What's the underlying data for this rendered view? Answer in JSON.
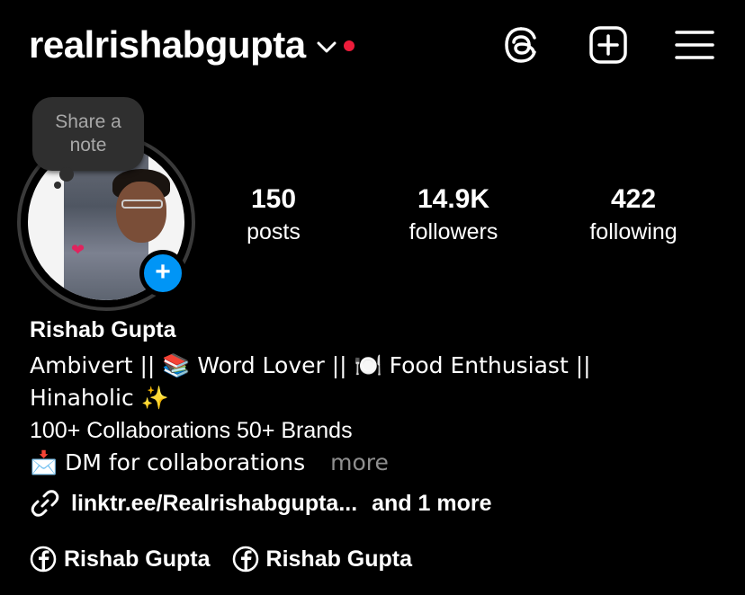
{
  "header": {
    "username": "realrishabgupta",
    "notification_color": "#ed1c3a"
  },
  "profile": {
    "note_placeholder": "Share a note",
    "add_story_symbol": "+",
    "avatar_heart": "❤"
  },
  "stats": [
    {
      "value": "150",
      "label": "posts"
    },
    {
      "value": "14.9K",
      "label": "followers"
    },
    {
      "value": "422",
      "label": "following"
    }
  ],
  "bio": {
    "name": "Rishab Gupta",
    "line1": "Ambivert || 📚 Word Lover || 🍽️ Food Enthusiast ||",
    "line2": "Hinaholic ✨",
    "line3": "100+ Collaborations 50+ Brands",
    "line4": "📩 DM for collaborations",
    "more_label": "more"
  },
  "links": {
    "url": "linktr.ee/Realrishabgupta...",
    "more_label": "and 1 more"
  },
  "facebook": [
    {
      "label": "Rishab Gupta"
    },
    {
      "label": "Rishab Gupta"
    }
  ],
  "icons": {
    "threads": "threads-icon",
    "new_post": "plus-square-icon",
    "menu": "hamburger-menu-icon",
    "link": "link-icon",
    "facebook": "facebook-icon",
    "dropdown": "chevron-down-icon"
  },
  "colors": {
    "background": "#000000",
    "text": "#ffffff",
    "accent_blue": "#0095f6",
    "muted": "#8e8e8e"
  }
}
